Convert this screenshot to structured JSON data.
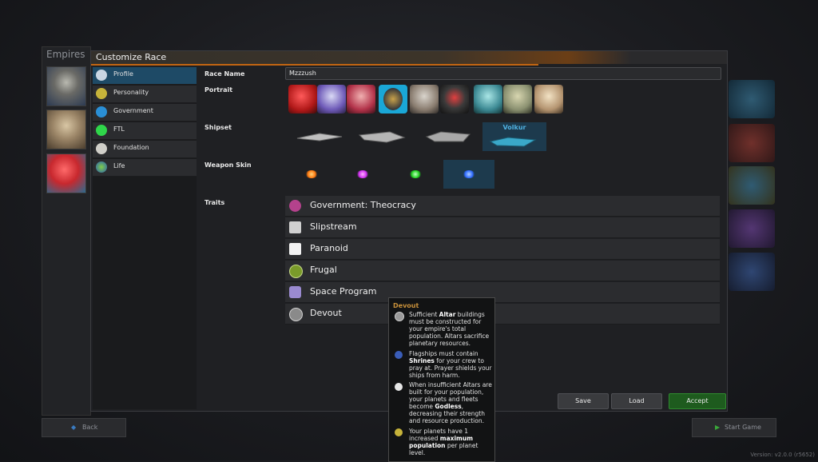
{
  "empires": {
    "title": "Empires",
    "portraits": [
      "gray-alien-portrait",
      "beige-alien-portrait",
      "red-alien-portrait"
    ]
  },
  "window": {
    "title": "Customize Race"
  },
  "sidebar": {
    "items": [
      {
        "label": "Profile",
        "icon": "profile-icon",
        "active": true
      },
      {
        "label": "Personality",
        "icon": "personality-icon",
        "active": false
      },
      {
        "label": "Government",
        "icon": "government-icon",
        "active": false
      },
      {
        "label": "FTL",
        "icon": "ftl-icon",
        "active": false
      },
      {
        "label": "Foundation",
        "icon": "foundation-icon",
        "active": false
      },
      {
        "label": "Life",
        "icon": "life-icon",
        "active": false
      }
    ]
  },
  "profile": {
    "race_name_label": "Race Name",
    "race_name_value": "Mzzzush",
    "portrait_label": "Portrait",
    "shipset_label": "Shipset",
    "shipsets": [
      {
        "name": "",
        "selected": false
      },
      {
        "name": "",
        "selected": false
      },
      {
        "name": "",
        "selected": false
      },
      {
        "name": "Volkur",
        "selected": true
      }
    ],
    "weapon_skin_label": "Weapon Skin",
    "weapon_skins": [
      {
        "color": "#ff8a1a",
        "selected": false
      },
      {
        "color": "#e040ff",
        "selected": false
      },
      {
        "color": "#33ee33",
        "selected": false
      },
      {
        "color": "#2f7bff",
        "selected": true
      }
    ],
    "traits_label": "Traits",
    "traits": [
      {
        "label": "Government: Theocracy",
        "icon": "theocracy-icon"
      },
      {
        "label": "Slipstream",
        "icon": "slipstream-icon"
      },
      {
        "label": "Paranoid",
        "icon": "paranoid-icon"
      },
      {
        "label": "Frugal",
        "icon": "frugal-icon"
      },
      {
        "label": "Space Program",
        "icon": "space-program-icon"
      },
      {
        "label": "Devout",
        "icon": "devout-icon"
      }
    ]
  },
  "buttons": {
    "save": "Save",
    "load": "Load",
    "accept": "Accept"
  },
  "bottom": {
    "back": "Back",
    "start": "Start Game"
  },
  "tooltip": {
    "title": "Devout",
    "entries": [
      {
        "pre": "Sufficient ",
        "b1": "Altar",
        "mid": " buildings must be constructed for your empire's total population. Altars sacrifice planetary resources.",
        "b2": "",
        "post": ""
      },
      {
        "pre": "Flagships must contain ",
        "b1": "Shrines",
        "mid": " for your crew to pray at. Prayer shields your ships from harm.",
        "b2": "",
        "post": ""
      },
      {
        "pre": "When insufficient Altars are built for your population, your planets and fleets become ",
        "b1": "Godless",
        "mid": ", decreasing their strength and resource production.",
        "b2": "",
        "post": ""
      },
      {
        "pre": "Your planets have 1 increased ",
        "b1": "maximum population",
        "mid": " per planet level.",
        "b2": "",
        "post": ""
      }
    ]
  },
  "version": "Version: v2.0.0 (r5652)"
}
